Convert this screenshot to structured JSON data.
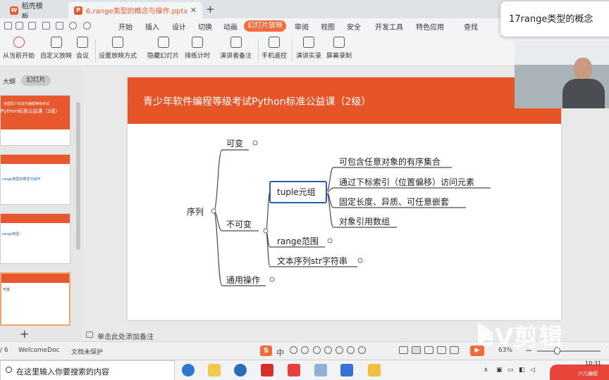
{
  "window": {
    "tabs": [
      {
        "label": "稻壳模板"
      },
      {
        "label": "6.range类型的概念与操作.pptx",
        "close": "✕"
      }
    ],
    "new_tab": "+"
  },
  "ribbon": {
    "menu": [
      "开始",
      "插入",
      "设计",
      "切换",
      "动画",
      "幻灯片放映",
      "审阅",
      "视图",
      "安全",
      "开发工具",
      "特色应用",
      "查找"
    ],
    "active_menu": "幻灯片放映",
    "tools": [
      "从当前开始",
      "自定义放映",
      "会议",
      "设置放映方式",
      "隐藏幻灯片",
      "排练计时",
      "演讲者备注",
      "手机遥控",
      "演讲实录",
      "屏幕录制"
    ]
  },
  "toast": {
    "text": "17range类型的概念"
  },
  "left_panel": {
    "tab_outline": "大纲",
    "tab_slides": "幻灯片",
    "thumb1_title": "全国青少年软件编程等级考试",
    "thumb1_sub": "Python标准公益课（2级）",
    "thumb2_text": "range类型的概念与操作",
    "thumb3_text": "range类型：",
    "thumb4_text": "可变",
    "add_label": "+"
  },
  "slide": {
    "title": "青少年软件编程等级考试Python标准公益课（2级）",
    "mindmap": {
      "root": "序列",
      "mutable": "可变",
      "immutable": "不可变",
      "common_ops": "通用操作",
      "tuple": "tuple元组",
      "range": "range范围",
      "str": "文本序列str字符串",
      "tuple_items": [
        "可包含任意对象的有序集合",
        "通过下标索引（位置偏移）访问元素",
        "固定长度、异质、可任意嵌套",
        "对象引用数组"
      ]
    }
  },
  "notes": {
    "placeholder": "单击此处添加备注"
  },
  "status": {
    "page": "/ 6",
    "theme": "WelcomeDoc",
    "protect": "文档未保护",
    "ime": "S",
    "ime_lang": "中",
    "zoom": "63%",
    "zoom_minus": "−"
  },
  "watermark": "eV剪辑",
  "taskbar": {
    "search": "在这里输入你要搜索的内容",
    "time": "10:31",
    "tray_text": "少儿编程"
  },
  "colors": {
    "accent": "#e65528",
    "slide_bg": "#ffffff",
    "tree_line": "#4a4a4a"
  }
}
